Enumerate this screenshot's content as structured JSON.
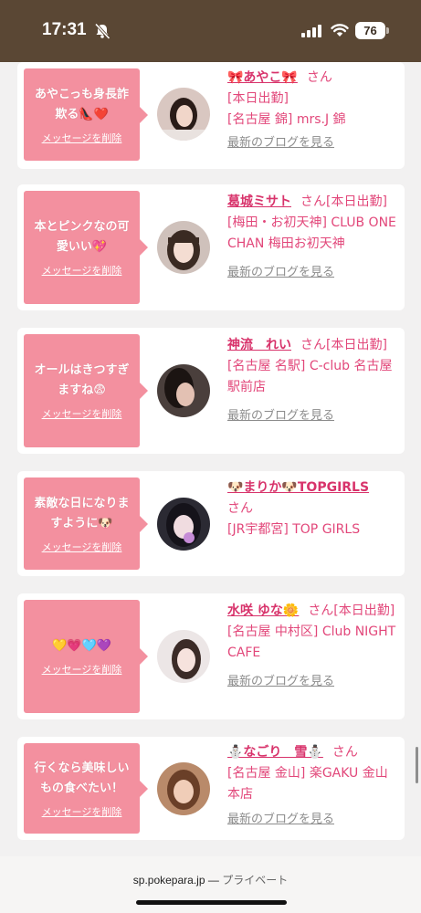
{
  "status_bar": {
    "time": "17:31",
    "battery": "76",
    "icons": [
      "bell-slash-icon",
      "signal-icon",
      "wifi-icon",
      "battery-icon"
    ]
  },
  "cards": [
    {
      "message": "あやこっも身長詐欺る👠❤️",
      "delete_label": "メッセージを削除",
      "name": "🎀あやこ🎀",
      "san": "さん",
      "details": [
        "[本日出勤]",
        "[名古屋 錦] mrs.J 錦"
      ],
      "blog": "最新のブログを見る"
    },
    {
      "message": "本とピンクなの可愛いい💖",
      "delete_label": "メッセージを削除",
      "name": "葛城ミサト",
      "san": "さん[本日出勤]",
      "details": [
        "[梅田・お初天神] CLUB ONE CHAN 梅田お初天神"
      ],
      "blog": "最新のブログを見る"
    },
    {
      "message": "オールはきつすぎますね😨",
      "delete_label": "メッセージを削除",
      "name": "神流　れい",
      "san": "さん[本日出勤]",
      "details": [
        "[名古屋 名駅] C-club 名古屋駅前店"
      ],
      "blog": "最新のブログを見る"
    },
    {
      "message": "素敵な日になりますように🐶",
      "delete_label": "メッセージを削除",
      "name": "🐶まりか🐶TOPGIRLS",
      "san": "さん",
      "details": [
        "[JR宇都宮] TOP GIRLS"
      ],
      "blog": ""
    },
    {
      "message": "💛💗🩵💜",
      "delete_label": "メッセージを削除",
      "name": "水咲 ゆな🌼",
      "san": "さん[本日出勤]",
      "details": [
        "[名古屋 中村区] Club NIGHT CAFE"
      ],
      "blog": "最新のブログを見る"
    },
    {
      "message": "行くなら美味しいもの食べたい！",
      "delete_label": "メッセージを削除",
      "name": "⛄なごり　雪⛄",
      "san": "さん",
      "details": [
        "[名古屋 金山] 楽GAKU 金山本店"
      ],
      "blog": "最新のブログを見る"
    }
  ],
  "bottom_bar": {
    "domain": "sp.pokepara.jp",
    "separator": " — ",
    "mode": "プライベート"
  },
  "colors": {
    "status_bar": "#5a4734",
    "message_bubble": "#f3909f",
    "accent_pink": "#e2477a",
    "background": "#f2f1f1"
  }
}
